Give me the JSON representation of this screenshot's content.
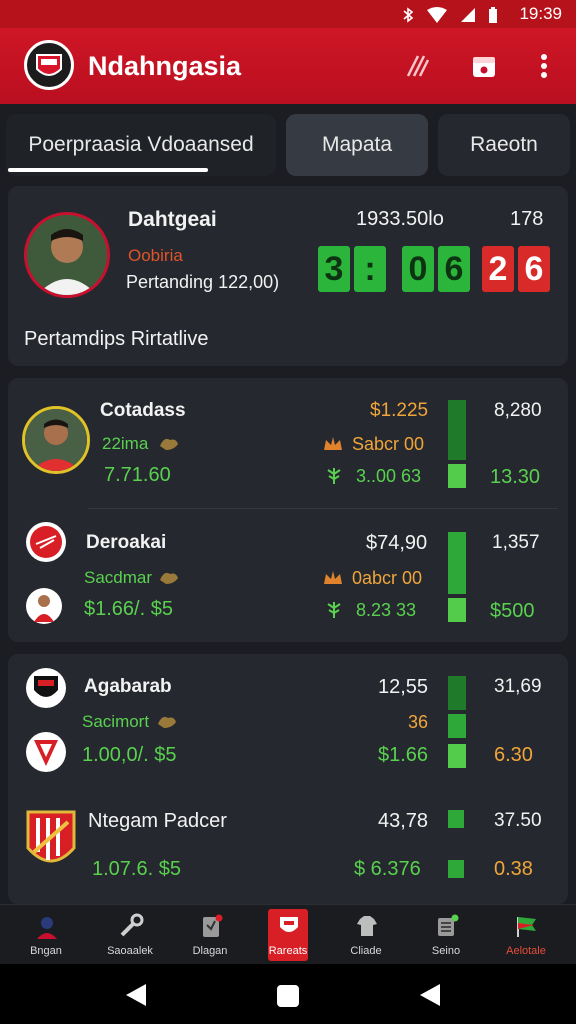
{
  "status_bar": {
    "time": "19:39"
  },
  "app_bar": {
    "title": "Ndahngasia"
  },
  "tabs": [
    {
      "label": "Poerpraasia Vdoaansed"
    },
    {
      "label": "Mapata"
    },
    {
      "label": "Raeotn"
    }
  ],
  "featured": {
    "name": "Dahtgeai",
    "status": "Oobiria",
    "detail": "Pertanding 122,00)",
    "stat_a": "1933.50lo",
    "stat_b": "178",
    "score": [
      "3",
      ":",
      "0",
      "6",
      "2",
      "6"
    ],
    "footer": "Pertamdips Rirtatlive"
  },
  "group1": {
    "row1": {
      "name": "Cotadass",
      "sub": "22ima",
      "value": "7.71.60",
      "price": "$1.225",
      "price2": "8,280",
      "mid_label": "Sabcr 00",
      "mid_value": "3..00 63",
      "right_value": "13.30"
    },
    "row2": {
      "name": "Deroakai",
      "sub": "Sacdmar",
      "value": "$1.66/. $5",
      "price": "$74,90",
      "price2": "1,357",
      "mid_label": "0abcr 00",
      "mid_value": "8.23 33",
      "right_value": "$500"
    }
  },
  "group2": {
    "row1": {
      "name": "Agabarab",
      "sub": "Sacimort",
      "value": "1.00,0/. $5",
      "price": "12,55",
      "price2": "31,69",
      "mid_label": "36",
      "mid_value": "$1.66",
      "right_value": "6.30"
    },
    "row2": {
      "name": "Ntegam Padcer",
      "value": "1.07.6. $5",
      "price": "43,78",
      "price2": "37.50",
      "mid_value": "$ 6.376",
      "right_value": "0.38"
    }
  },
  "bottom_nav": [
    {
      "label": "Bngan"
    },
    {
      "label": "Saoaalek"
    },
    {
      "label": "Dlagan"
    },
    {
      "label": "Rareats"
    },
    {
      "label": "Cliade"
    },
    {
      "label": "Seino"
    },
    {
      "label": "Aelotale"
    }
  ],
  "colors": {
    "brand_red": "#c8102e",
    "positive_green": "#59d14f",
    "accent_orange": "#f0a53a",
    "card_bg": "#25282e"
  }
}
